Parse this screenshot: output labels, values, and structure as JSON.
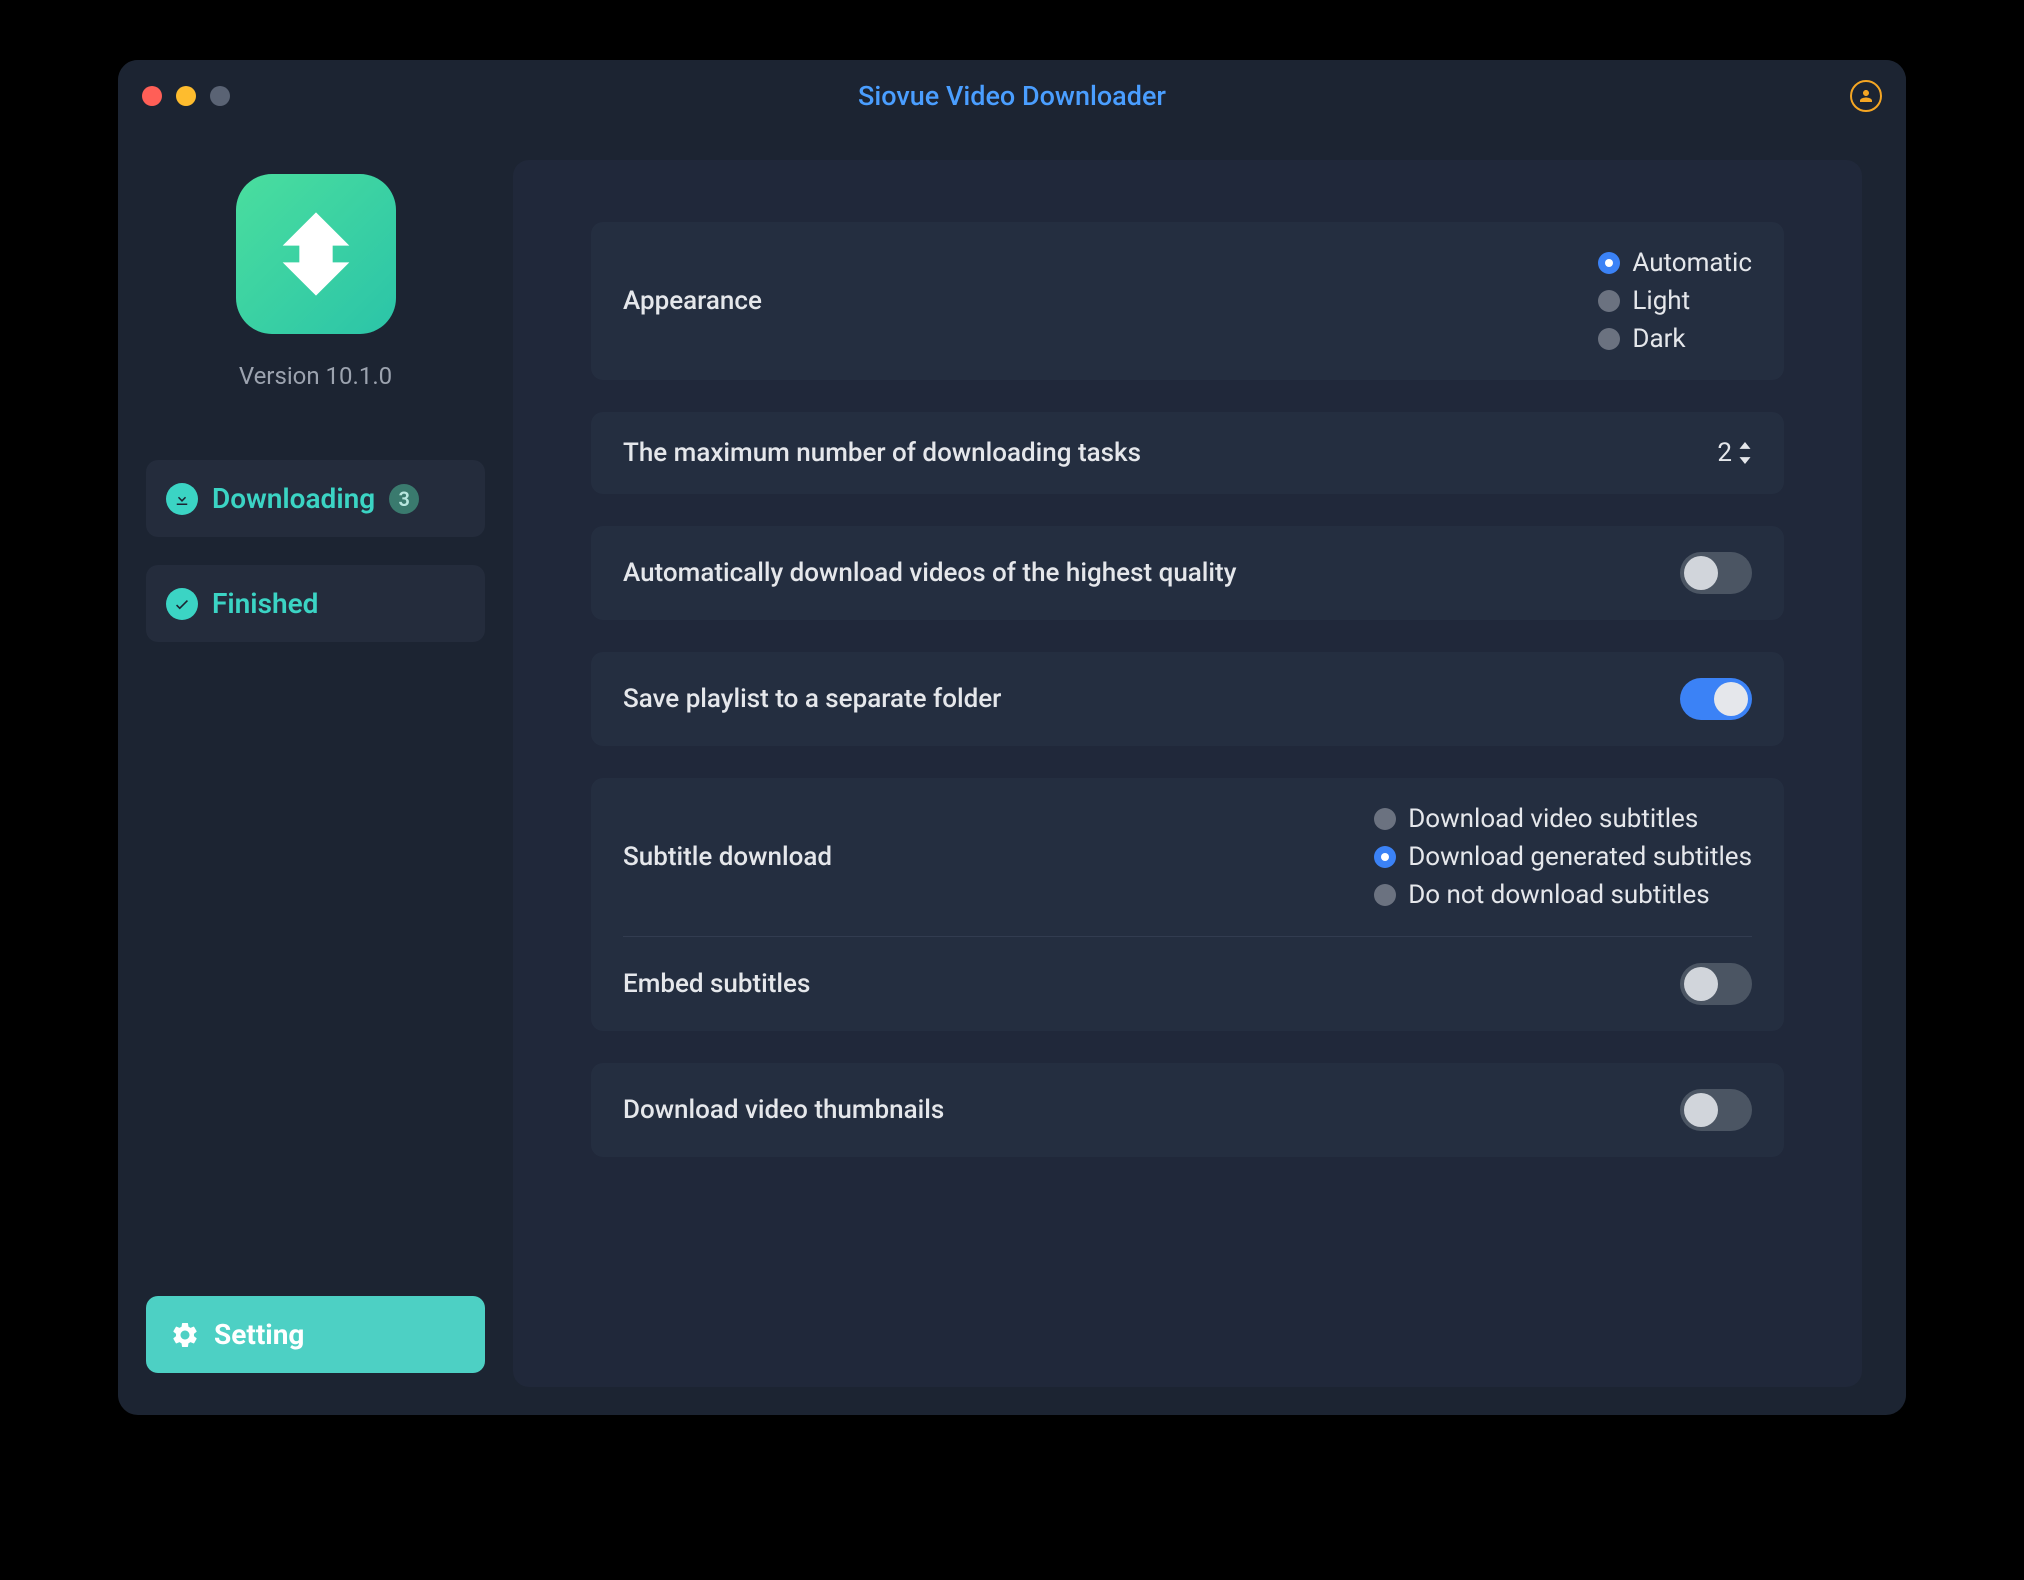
{
  "app": {
    "title": "Siovue Video Downloader",
    "version": "Version 10.1.0"
  },
  "sidebar": {
    "items": [
      {
        "label": "Downloading",
        "badge": "3",
        "icon": "download"
      },
      {
        "label": "Finished",
        "icon": "check"
      }
    ],
    "setting_label": "Setting"
  },
  "settings": {
    "appearance": {
      "label": "Appearance",
      "options": [
        "Automatic",
        "Light",
        "Dark"
      ],
      "selected": "Automatic"
    },
    "max_tasks": {
      "label": "The maximum number of downloading tasks",
      "value": "2"
    },
    "auto_quality": {
      "label": "Automatically download videos of the highest quality",
      "value": false
    },
    "playlist_folder": {
      "label": "Save playlist to a separate folder",
      "value": true
    },
    "subtitle": {
      "label": "Subtitle download",
      "options": [
        "Download video subtitles",
        "Download generated subtitles",
        "Do not download subtitles"
      ],
      "selected": "Download generated subtitles"
    },
    "embed_subtitles": {
      "label": "Embed subtitles",
      "value": false
    },
    "thumbnails": {
      "label": "Download video thumbnails",
      "value": false
    }
  }
}
